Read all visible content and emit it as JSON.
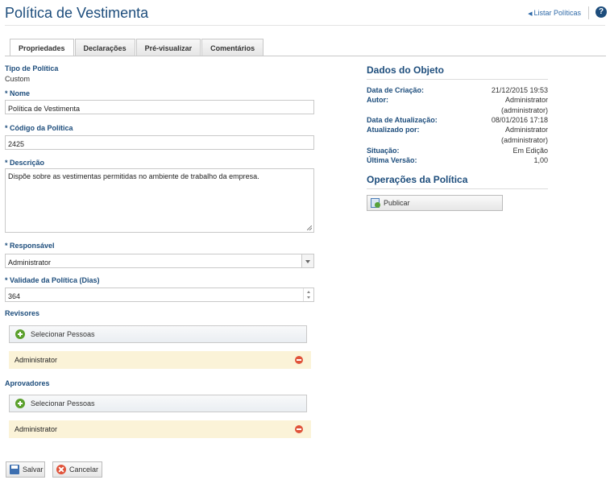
{
  "page": {
    "title": "Política de Vestimenta"
  },
  "header": {
    "list_link": "Listar Políticas",
    "help_icon": "help-icon"
  },
  "tabs": [
    {
      "label": "Propriedades",
      "active": true
    },
    {
      "label": "Declarações",
      "active": false
    },
    {
      "label": "Pré-visualizar",
      "active": false
    },
    {
      "label": "Comentários",
      "active": false
    }
  ],
  "form": {
    "tipo_label": "Tipo de Política",
    "tipo_value": "Custom",
    "nome_label": "* Nome",
    "nome_value": "Política de Vestimenta",
    "codigo_label": "* Código da Política",
    "codigo_value": "2425",
    "descricao_label": "* Descrição",
    "descricao_value": "Dispõe sobre as vestimentas permitidas no ambiente de trabalho da empresa.",
    "responsavel_label": "* Responsável",
    "responsavel_value": "Administrator",
    "validade_label": "* Validade da Política (Dias)",
    "validade_value": "364",
    "revisores_label": "Revisores",
    "revisores_select": "Selecionar Pessoas",
    "revisores_items": [
      "Administrator"
    ],
    "aprovadores_label": "Aprovadores",
    "aprovadores_select": "Selecionar Pessoas",
    "aprovadores_items": [
      "Administrator"
    ]
  },
  "object_data": {
    "title": "Dados do Objeto",
    "rows": [
      {
        "label": "Data de Criação:",
        "value": "21/12/2015 19:53"
      },
      {
        "label": "Autor:",
        "value": "Administrator"
      },
      {
        "label": "",
        "value": "(administrator)"
      },
      {
        "label": "Data de Atualização:",
        "value": "08/01/2016 17:18"
      },
      {
        "label": "Atualizado por:",
        "value": "Administrator"
      },
      {
        "label": "",
        "value": "(administrator)"
      },
      {
        "label": "Situação:",
        "value": "Em Edição"
      },
      {
        "label": "Última Versão:",
        "value": "1,00"
      }
    ]
  },
  "operations": {
    "title": "Operações da Política",
    "publish_label": "Publicar"
  },
  "footer": {
    "save_label": "Salvar",
    "cancel_label": "Cancelar"
  }
}
